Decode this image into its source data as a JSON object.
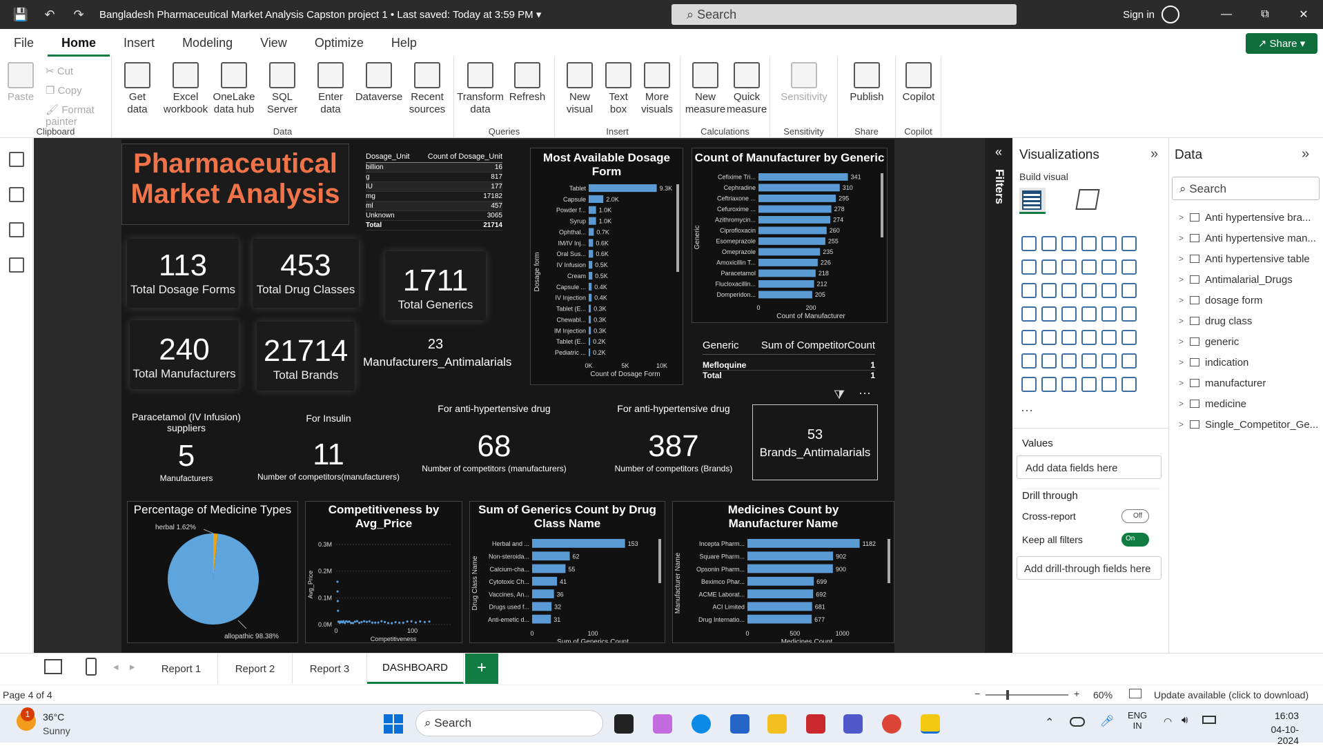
{
  "titlebar": {
    "title": "Bangladesh Pharmaceutical Market Analysis Capston project 1",
    "saved": "Last saved: Today at 3:59 PM",
    "search_placeholder": "Search",
    "signin": "Sign in"
  },
  "menu": [
    "File",
    "Home",
    "Insert",
    "Modeling",
    "View",
    "Optimize",
    "Help"
  ],
  "share_label": "Share",
  "ribbon": {
    "clipboard": {
      "paste": "Paste",
      "cut": "Cut",
      "copy": "Copy",
      "format_painter": "Format painter",
      "label": "Clipboard"
    },
    "data": {
      "buttons": [
        [
          "Get",
          "data"
        ],
        [
          "Excel",
          "workbook"
        ],
        [
          "OneLake",
          "data hub"
        ],
        [
          "SQL",
          "Server"
        ],
        [
          "Enter",
          "data"
        ],
        [
          "Dataverse",
          ""
        ],
        [
          "Recent",
          "sources"
        ]
      ],
      "label": "Data"
    },
    "queries": {
      "buttons": [
        [
          "Transform",
          "data"
        ],
        [
          "Refresh",
          ""
        ]
      ],
      "label": "Queries"
    },
    "insert": {
      "buttons": [
        [
          "New",
          "visual"
        ],
        [
          "Text",
          "box"
        ],
        [
          "More",
          "visuals"
        ]
      ],
      "label": "Insert"
    },
    "calculations": {
      "buttons": [
        [
          "New",
          "measure"
        ],
        [
          "Quick",
          "measure"
        ]
      ],
      "label": "Calculations"
    },
    "sensitivity": {
      "buttons": [
        [
          "Sensitivity",
          ""
        ]
      ],
      "label": "Sensitivity"
    },
    "share": {
      "buttons": [
        [
          "Publish",
          ""
        ]
      ],
      "label": "Share"
    },
    "copilot": {
      "buttons": [
        [
          "Copilot",
          ""
        ]
      ],
      "label": "Copilot"
    }
  },
  "report": {
    "title_line1": "Pharmaceutical",
    "title_line2": "Market Analysis",
    "dosage_table": {
      "headers": [
        "Dosage_Unit",
        "Count of Dosage_Unit"
      ],
      "rows": [
        [
          "billion",
          "16"
        ],
        [
          "g",
          "817"
        ],
        [
          "IU",
          "177"
        ],
        [
          "mg",
          "17182"
        ],
        [
          "ml",
          "457"
        ],
        [
          "Unknown",
          "3065"
        ]
      ],
      "total": [
        "Total",
        "21714"
      ]
    },
    "cards": [
      {
        "value": "113",
        "label": "Total Dosage Forms"
      },
      {
        "value": "453",
        "label": "Total Drug Classes"
      },
      {
        "value": "1711",
        "label": "Total Generics"
      },
      {
        "value": "240",
        "label": "Total Manufacturers"
      },
      {
        "value": "21714",
        "label": "Total Brands"
      }
    ],
    "antimalarial_mfr": {
      "value": "23",
      "label": "Manufacturers_Antimalarials"
    },
    "competitor_table": {
      "headers": [
        "Generic",
        "Sum of CompetitorCount"
      ],
      "rows": [
        [
          "Mefloquine",
          "1"
        ]
      ],
      "total": [
        "Total",
        "1"
      ]
    },
    "kpis": [
      {
        "caption": "Paracetamol (IV Infusion) suppliers",
        "value": "5",
        "sub": "Manufacturers"
      },
      {
        "caption": "For Insulin",
        "value": "11",
        "sub": "Number of competitors(manufacturers)"
      },
      {
        "caption": "For anti-hypertensive drug",
        "value": "68",
        "sub": "Number of competitors (manufacturers)"
      },
      {
        "caption": "For anti-hypertensive drug",
        "value": "387",
        "sub": "Number of competitors (Brands)"
      }
    ],
    "antimalarial_brands": {
      "value": "53",
      "label": "Brands_Antimalarials"
    }
  },
  "chart_data": [
    {
      "type": "bar",
      "title": "Most Available Dosage Form",
      "xlabel": "Count of Dosage Form",
      "ylabel": "Dosage form",
      "xticks": [
        "0K",
        "5K",
        "10K"
      ],
      "xlim": [
        0,
        10000
      ],
      "categories": [
        "Tablet",
        "Capsule",
        "Powder f...",
        "Syrup",
        "Ophthal...",
        "IM/IV Inj...",
        "Oral Sus...",
        "IV Infusion",
        "Cream",
        "Capsule ...",
        "IV Injection",
        "Tablet (E...",
        "Chewabl...",
        "IM Injection",
        "Tablet (E...",
        "Pediatric ..."
      ],
      "values": [
        9300,
        2000,
        1000,
        1000,
        700,
        600,
        600,
        500,
        500,
        400,
        400,
        300,
        300,
        300,
        200,
        200
      ],
      "labels": [
        "9.3K",
        "2.0K",
        "1.0K",
        "1.0K",
        "0.7K",
        "0.6K",
        "0.6K",
        "0.5K",
        "0.5K",
        "0.4K",
        "0.4K",
        "0.3K",
        "0.3K",
        "0.3K",
        "0.2K",
        "0.2K"
      ]
    },
    {
      "type": "bar",
      "title": "Count of Manufacturer by Generic",
      "xlabel": "Count of Manufacturer",
      "ylabel": "Generic",
      "xticks": [
        "0",
        "200"
      ],
      "xlim": [
        0,
        400
      ],
      "categories": [
        "Cefixime Tri...",
        "Cephradine",
        "Ceftriaxone ...",
        "Cefuroxime ...",
        "Azithromycin...",
        "Ciprofloxacin",
        "Esomeprazole",
        "Omeprazole",
        "Amoxicillin T...",
        "Paracetamol",
        "Flucloxacillin...",
        "Domperidon..."
      ],
      "values": [
        341,
        310,
        295,
        278,
        274,
        260,
        255,
        235,
        226,
        218,
        212,
        205
      ]
    },
    {
      "type": "pie",
      "title": "Percentage of Medicine Types",
      "categories": [
        "allopathic",
        "herbal"
      ],
      "values": [
        98.38,
        1.62
      ],
      "labels": [
        "allopathic 98.38%",
        "herbal 1.62%"
      ]
    },
    {
      "type": "scatter",
      "title": "Competitiveness by Avg_Price",
      "xlabel": "Competitiveness",
      "ylabel": "Avg_Price",
      "yticks": [
        "0.0M",
        "0.1M",
        "0.2M",
        "0.3M"
      ],
      "xticks": [
        "0",
        "100"
      ],
      "xlim": [
        0,
        150
      ],
      "ylim": [
        0,
        0.3
      ]
    },
    {
      "type": "bar",
      "title": "Sum of Generics Count by Drug Class Name",
      "xlabel": "Sum of Generics Count",
      "ylabel": "Drug Class Name",
      "xticks": [
        "0",
        "100"
      ],
      "xlim": [
        0,
        200
      ],
      "categories": [
        "Herbal and ...",
        "Non-steroida...",
        "Calcium-cha...",
        "Cytotoxic Ch...",
        "Vaccines, An...",
        "Drugs used f...",
        "Anti-emetic d..."
      ],
      "values": [
        153,
        62,
        55,
        41,
        36,
        32,
        31
      ]
    },
    {
      "type": "bar",
      "title": "Medicines Count by Manufacturer Name",
      "xlabel": "Medicines Count",
      "ylabel": "Manufacturer Name",
      "xticks": [
        "0",
        "500",
        "1000"
      ],
      "xlim": [
        0,
        1250
      ],
      "categories": [
        "Incepta Pharm...",
        "Square Pharm...",
        "Opsonin Pharm...",
        "Beximco Phar...",
        "ACME Laborat...",
        "ACI Limited",
        "Drug Internatio..."
      ],
      "values": [
        1182,
        902,
        900,
        699,
        692,
        681,
        677
      ]
    }
  ],
  "filters_label": "Filters",
  "visualizations": {
    "title": "Visualizations",
    "build": "Build visual",
    "values": "Values",
    "add_fields": "Add data fields here",
    "drill": "Drill through",
    "cross": "Cross-report",
    "cross_state": "Off",
    "keep": "Keep all filters",
    "keep_state": "On",
    "add_drill": "Add drill-through fields here"
  },
  "datapane": {
    "title": "Data",
    "search": "Search",
    "fields": [
      "Anti hypertensive bra...",
      "Anti hypertensive man...",
      "Anti hypertensive table",
      "Antimalarial_Drugs",
      "dosage form",
      "drug class",
      "generic",
      "indication",
      "manufacturer",
      "medicine",
      "Single_Competitor_Ge..."
    ]
  },
  "tabs": [
    "Report 1",
    "Report 2",
    "Report 3",
    "DASHBOARD"
  ],
  "status": {
    "page": "Page 4 of 4",
    "zoom": "60%",
    "update": "Update available (click to download)"
  },
  "taskbar": {
    "temp": "36°C",
    "weather": "Sunny",
    "search": "Search",
    "lang1": "ENG",
    "lang2": "IN",
    "time": "16:03",
    "date": "04-10-2024",
    "badge": "1"
  },
  "colors": {
    "bar": "#5b9bd5",
    "title_orange": "#f0734a",
    "accent": "#107c41"
  }
}
